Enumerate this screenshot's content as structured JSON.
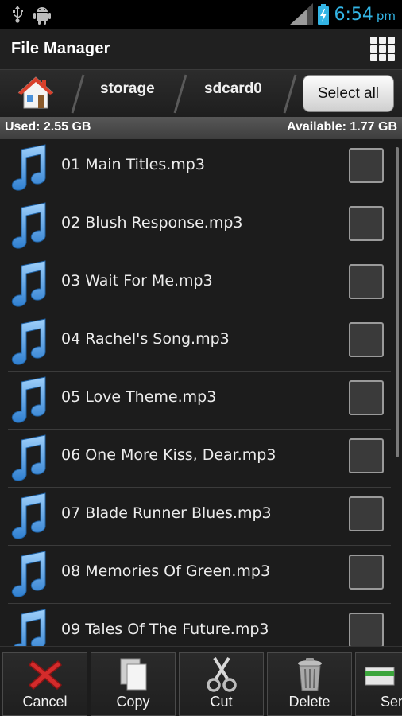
{
  "status_bar": {
    "time": "6:54",
    "ampm": "pm",
    "icons": [
      "usb-icon",
      "android-debug-icon",
      "signal-icon",
      "battery-charging-icon"
    ]
  },
  "app": {
    "title": "File Manager"
  },
  "breadcrumb": {
    "home_icon": "home-icon",
    "items": [
      "storage",
      "sdcard0"
    ],
    "select_all": "Select all"
  },
  "storage": {
    "used": "Used: 2.55 GB",
    "available": "Available: 1.77 GB"
  },
  "files": [
    {
      "name": "01 Main Titles.mp3",
      "checked": false
    },
    {
      "name": "02 Blush Response.mp3",
      "checked": false
    },
    {
      "name": "03 Wait For Me.mp3",
      "checked": false
    },
    {
      "name": "04 Rachel's Song.mp3",
      "checked": false
    },
    {
      "name": "05 Love Theme.mp3",
      "checked": false
    },
    {
      "name": "06 One More Kiss, Dear.mp3",
      "checked": false
    },
    {
      "name": "07 Blade Runner Blues.mp3",
      "checked": false
    },
    {
      "name": "08 Memories Of Green.mp3",
      "checked": false
    },
    {
      "name": "09 Tales Of The Future.mp3",
      "checked": false
    }
  ],
  "toolbar": {
    "cancel": "Cancel",
    "copy": "Copy",
    "cut": "Cut",
    "delete": "Delete",
    "send": "Send"
  },
  "colors": {
    "accent": "#33b5e5",
    "note": "#5aa7e6"
  }
}
